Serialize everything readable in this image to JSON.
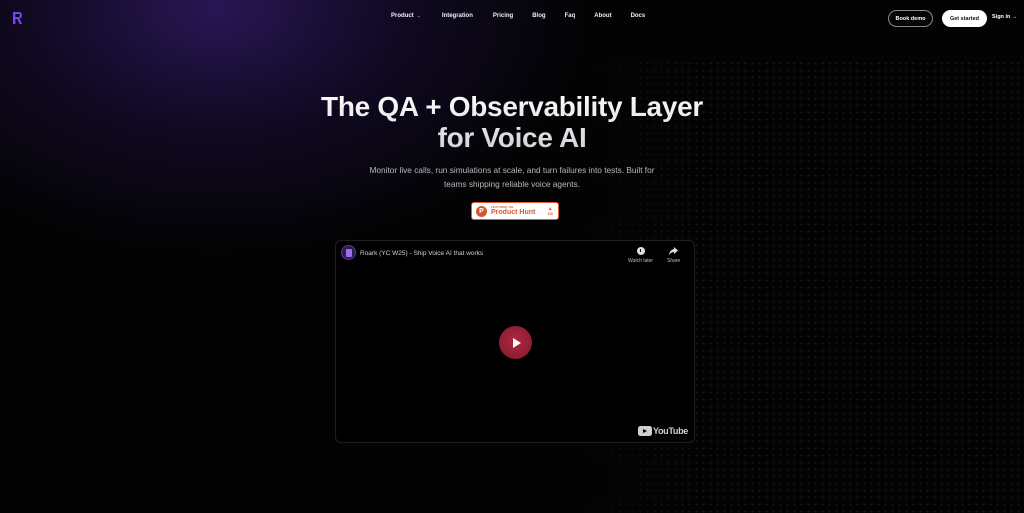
{
  "nav": {
    "items": [
      {
        "label": "Product",
        "has_dropdown": true
      },
      {
        "label": "Integration"
      },
      {
        "label": "Pricing"
      },
      {
        "label": "Blog"
      },
      {
        "label": "Faq"
      },
      {
        "label": "About"
      },
      {
        "label": "Docs"
      }
    ],
    "book_demo": "Book demo",
    "get_started": "Get started",
    "sign_in": "Sign in →"
  },
  "hero": {
    "title_line1": "The QA + Observability Layer",
    "title_line2": "for Voice AI",
    "subtitle_line1": "Monitor live calls, run simulations at scale, and turn failures into tests. Built for",
    "subtitle_line2": "teams shipping reliable voice agents."
  },
  "product_hunt": {
    "featured": "FEATURED ON",
    "name": "Product Hunt",
    "votes": "110",
    "logo_letter": "P"
  },
  "video": {
    "title": "Roark (YC W25) - Ship Voice AI that works",
    "watch_later": "Watch later",
    "share": "Share",
    "youtube": "YouTube"
  },
  "colors": {
    "background": "#030303",
    "accent_purple": "#6b3fd4",
    "product_hunt": "#da552f",
    "play_button": "#a6243a"
  },
  "icons": [
    "roark-logo-icon",
    "chevron-down-icon",
    "product-hunt-icon",
    "upvote-icon",
    "clock-icon",
    "share-icon",
    "play-icon",
    "youtube-logo-icon"
  ]
}
